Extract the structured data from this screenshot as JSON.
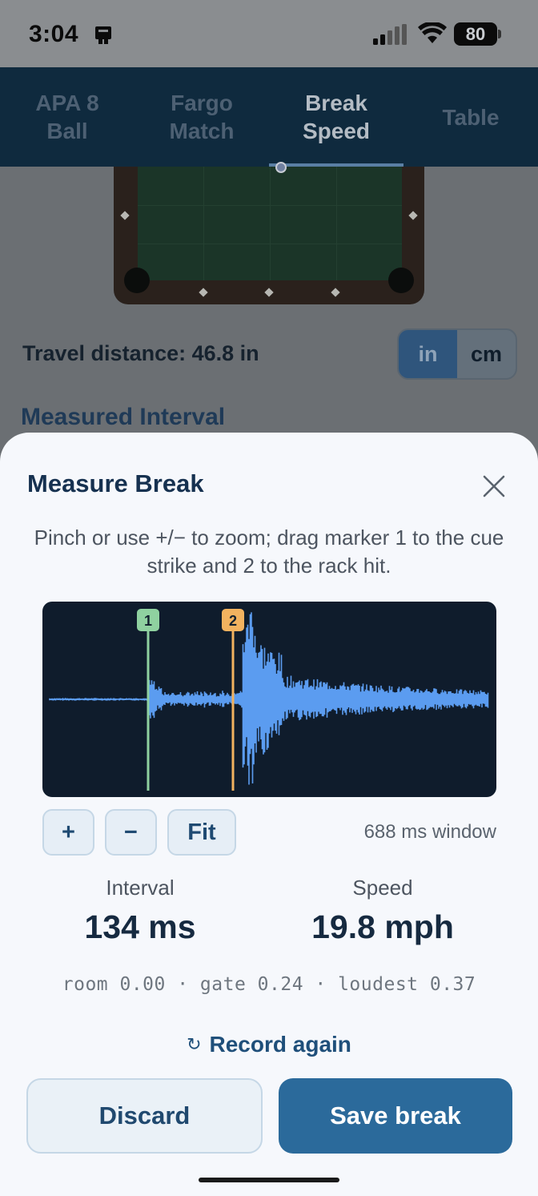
{
  "status_bar": {
    "time": "3:04",
    "battery": "80"
  },
  "tabs": [
    {
      "label": "APA 8\nBall",
      "active": false
    },
    {
      "label": "Fargo\nMatch",
      "active": false
    },
    {
      "label": "Break\nSpeed",
      "active": true
    },
    {
      "label": "Table",
      "active": false
    }
  ],
  "background": {
    "travel_distance": "Travel distance: 46.8 in",
    "units": [
      "in",
      "cm"
    ],
    "active_unit": "in",
    "section_header": "Measured Interval"
  },
  "sheet": {
    "title": "Measure Break",
    "hint": "Pinch or use +/− to zoom; drag marker 1 to the cue strike and 2 to the rack hit.",
    "markers": [
      {
        "label": "1",
        "color": "#8fd1a0"
      },
      {
        "label": "2",
        "color": "#f2b25f"
      }
    ],
    "zoom": {
      "plus": "+",
      "minus": "−",
      "fit": "Fit",
      "window": "688 ms window"
    },
    "metrics": {
      "interval_label": "Interval",
      "interval_value": "134 ms",
      "speed_label": "Speed",
      "speed_value": "19.8 mph"
    },
    "levels": "room 0.00 · gate 0.24 · loudest 0.37",
    "record_again": "Record again",
    "discard": "Discard",
    "save": "Save break"
  },
  "colors": {
    "accent": "#2b6a9b",
    "waveform": "#5b9cf0",
    "wave_bg": "#0f1c2c"
  }
}
